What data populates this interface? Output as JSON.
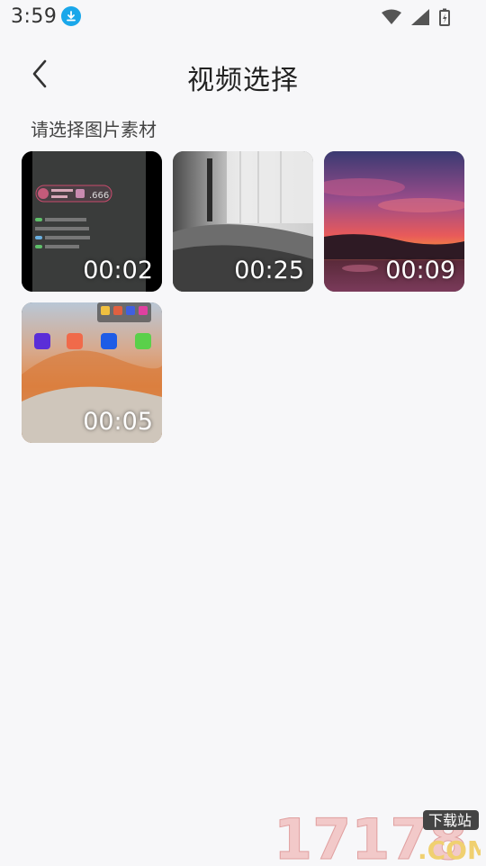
{
  "status_bar": {
    "time": "3:59",
    "icons": [
      "download-icon",
      "wifi-icon",
      "signal-icon",
      "battery-charging-icon"
    ]
  },
  "toolbar": {
    "back_icon": "chevron-left-icon",
    "title": "视频选择"
  },
  "subtitle": "请选择图片素材",
  "videos": [
    {
      "duration": "00:02",
      "thumb": "chat-screenshot"
    },
    {
      "duration": "00:25",
      "thumb": "bed-window"
    },
    {
      "duration": "00:09",
      "thumb": "sunset-sea"
    },
    {
      "duration": "00:05",
      "thumb": "desert-homescreen"
    }
  ],
  "watermark": {
    "digits": "17178",
    "domain": ".COM",
    "tag": "下载站"
  }
}
